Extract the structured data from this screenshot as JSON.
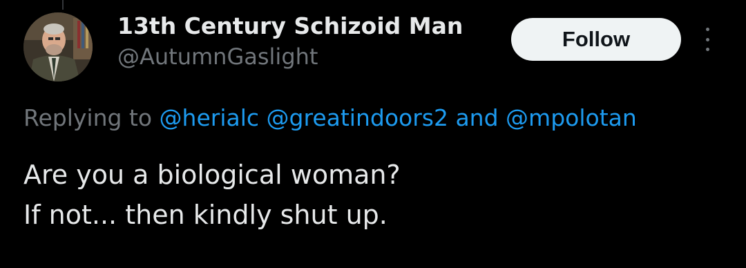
{
  "tweet": {
    "author": {
      "display_name": "13th Century Schizoid Man",
      "handle": "@AutumnGaslight",
      "avatar_icon": "profile-photo"
    },
    "follow_label": "Follow",
    "more_icon": "vertical-ellipsis-icon",
    "replying": {
      "prefix": "Replying to ",
      "mentions": [
        "@herialc",
        "@greatindoors2",
        "@mpolotan"
      ],
      "separator_1": " ",
      "conjunction": " and "
    },
    "text_lines": [
      "Are you a biological woman?",
      "If not... then kindly shut up."
    ]
  },
  "colors": {
    "background": "#000000",
    "primary_text": "#e7e9ea",
    "secondary_text": "#71767b",
    "link": "#1d9bf0",
    "button_bg": "#eff3f4",
    "button_text": "#0f1419"
  }
}
